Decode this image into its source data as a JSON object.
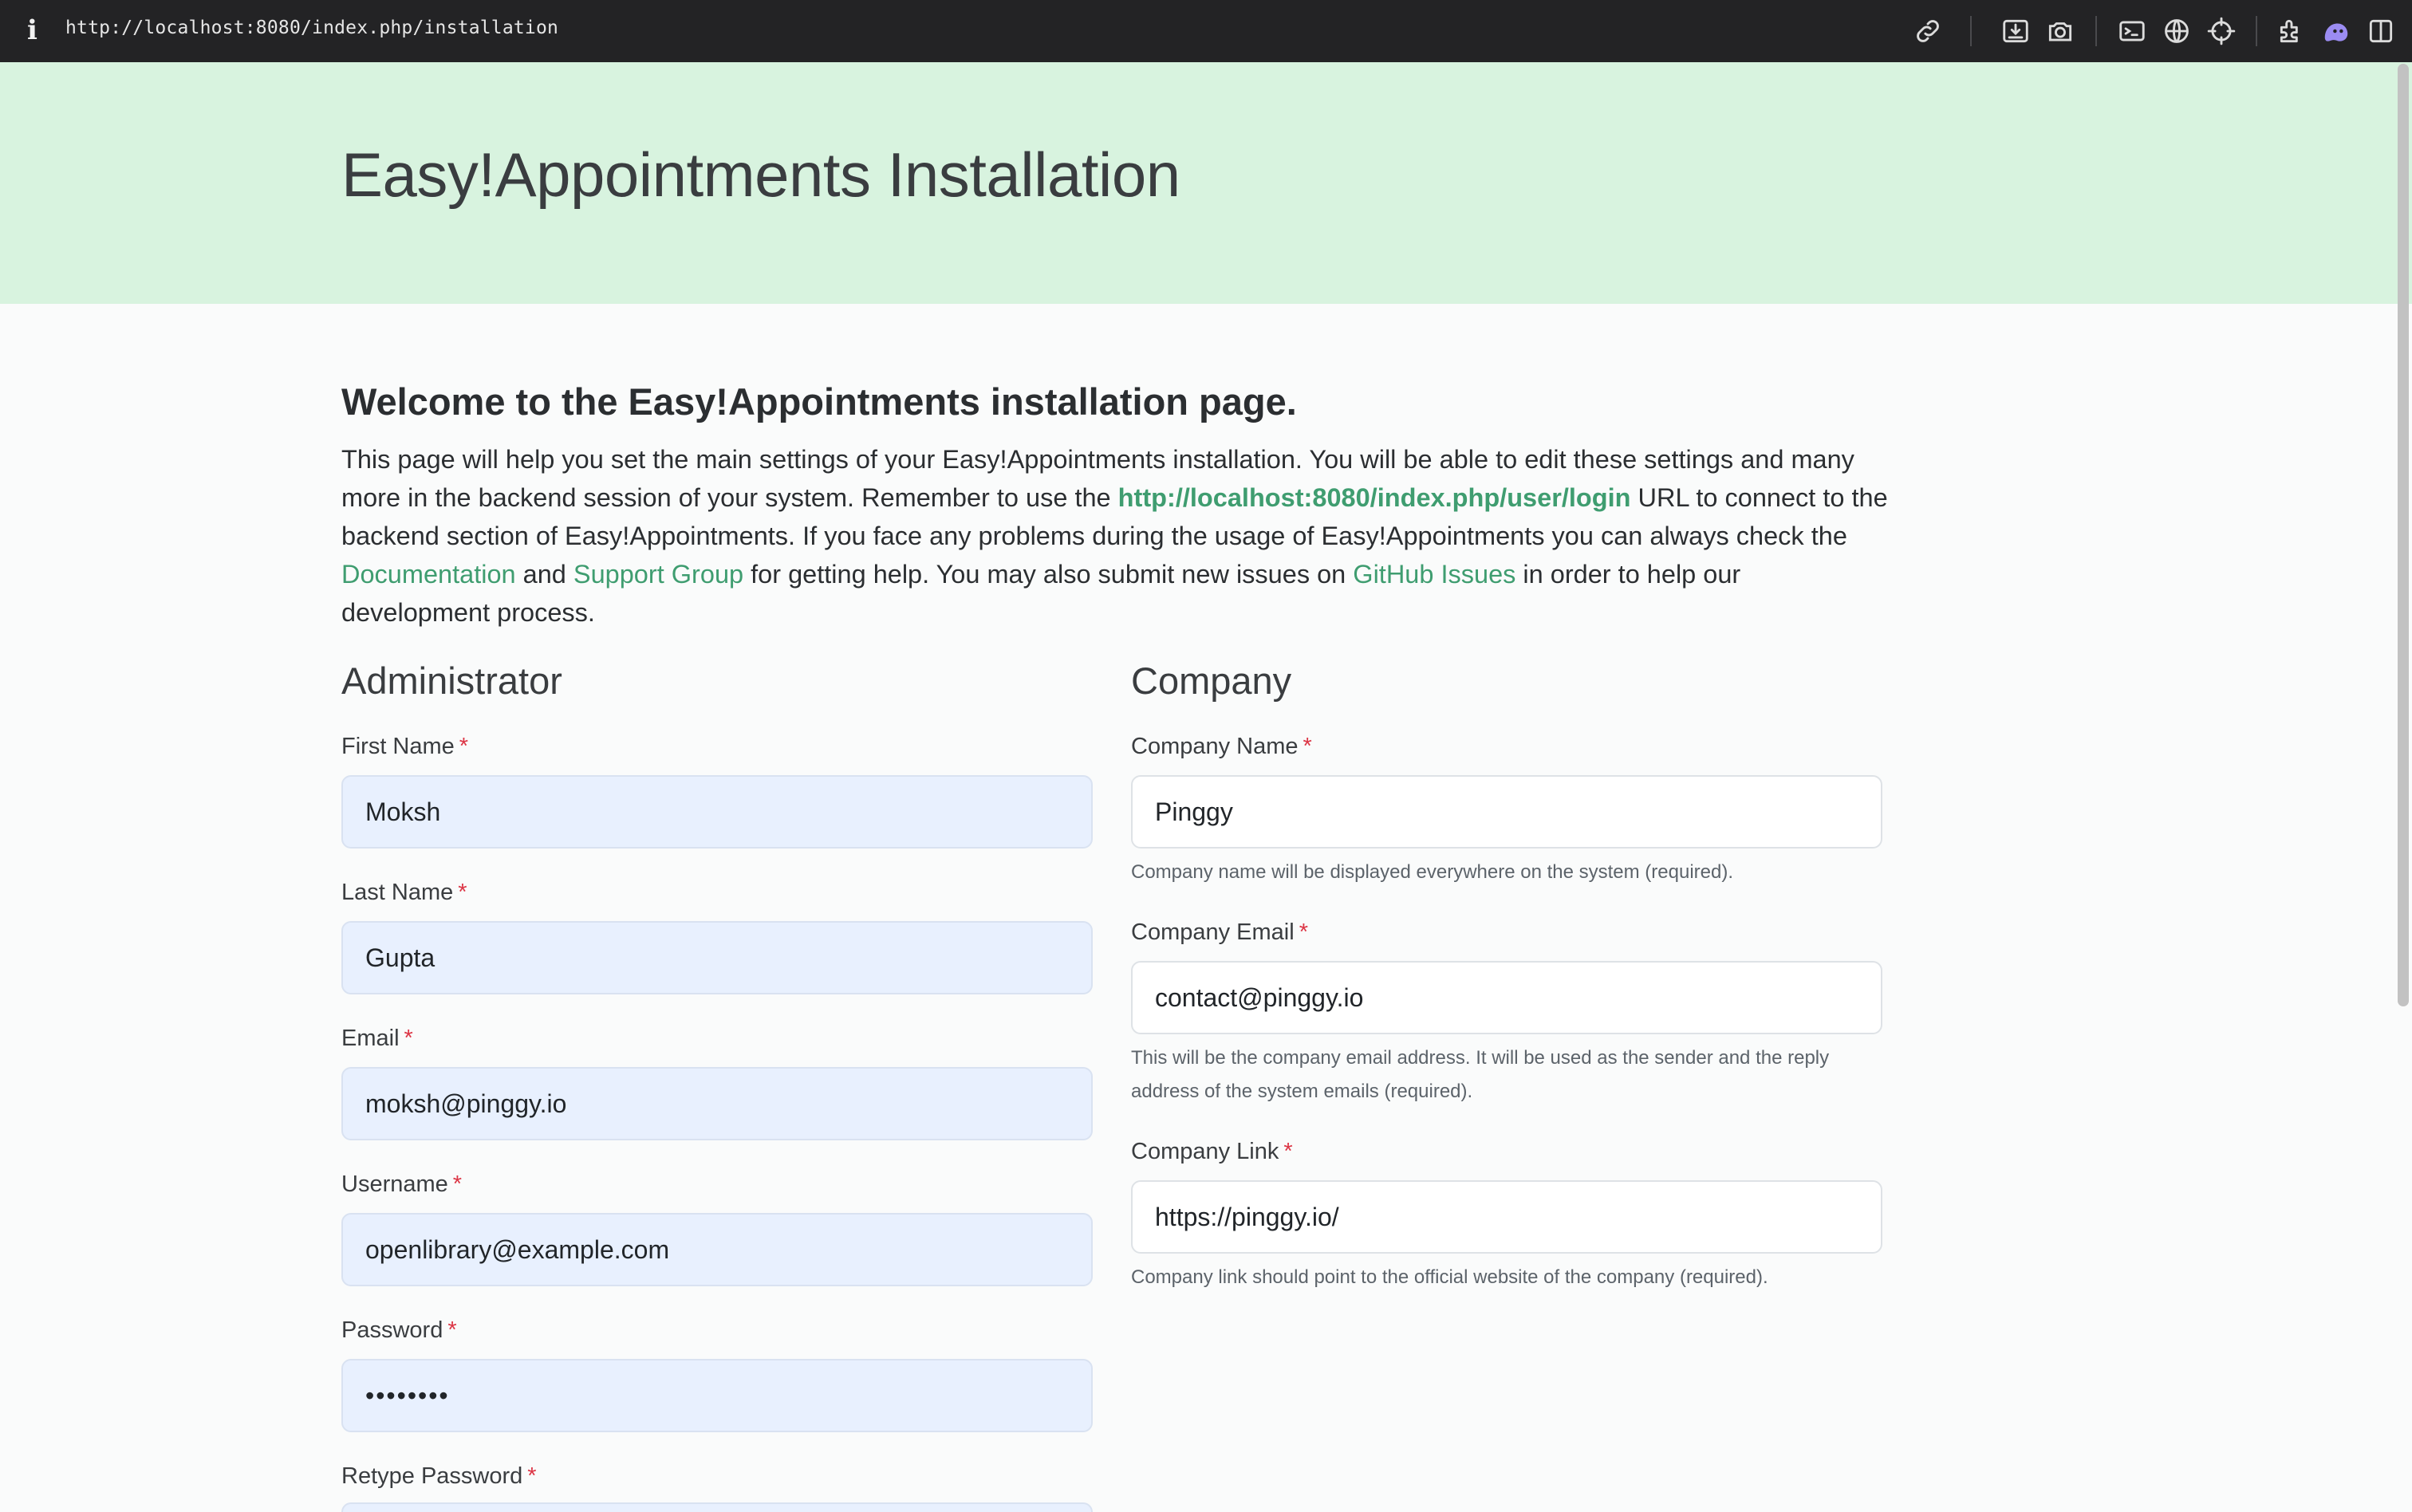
{
  "browser": {
    "url": "http://localhost:8080/index.php/installation",
    "info_glyph": "i",
    "icons": [
      "link-icon",
      "download-page-icon",
      "camera-icon",
      "terminal-icon",
      "globe-icon",
      "crosshair-icon",
      "extensions-icon",
      "ghost-extension-icon",
      "split-view-icon"
    ]
  },
  "header": {
    "title": "Easy!Appointments Installation",
    "background": "#d8f3df"
  },
  "intro": {
    "heading": "Welcome to the Easy!Appointments installation page.",
    "text_1": "This page will help you set the main settings of your Easy!Appointments installation. You will be able to edit these settings and many more in the backend session of your system. Remember to use the ",
    "login_url": "http://localhost:8080/index.php/user/login",
    "text_2": " URL to connect to the backend section of Easy!Appointments. If you face any problems during the usage of Easy!Appointments you can always check the ",
    "documentation_link": "Documentation",
    "text_3": " and ",
    "support_link": "Support Group",
    "text_4": " for getting help. You may also submit new issues on ",
    "github_link": "GitHub Issues",
    "text_5": " in order to help our development process.",
    "link_color": "#3f9d70"
  },
  "administrator": {
    "title": "Administrator",
    "first_name": {
      "label": "First Name",
      "required": "*",
      "value": "Moksh"
    },
    "last_name": {
      "label": "Last Name",
      "required": "*",
      "value": "Gupta"
    },
    "email": {
      "label": "Email",
      "required": "*",
      "value": "moksh@pinggy.io"
    },
    "username": {
      "label": "Username",
      "required": "*",
      "value": "openlibrary@example.com"
    },
    "password": {
      "label": "Password",
      "required": "*",
      "value": "••••••••"
    },
    "retype_password": {
      "label": "Retype Password",
      "required": "*"
    }
  },
  "company": {
    "title": "Company",
    "name": {
      "label": "Company Name",
      "required": "*",
      "value": "Pinggy",
      "help": "Company name will be displayed everywhere on the system (required)."
    },
    "email": {
      "label": "Company Email",
      "required": "*",
      "value": "contact@pinggy.io",
      "help": "This will be the company email address. It will be used as the sender and the reply address of the system emails (required)."
    },
    "link": {
      "label": "Company Link",
      "required": "*",
      "value": "https://pinggy.io/",
      "help": "Company link should point to the official website of the company (required)."
    }
  },
  "colors": {
    "autofill_bg": "#e8f0fe",
    "required_marker": "#dc3545"
  }
}
